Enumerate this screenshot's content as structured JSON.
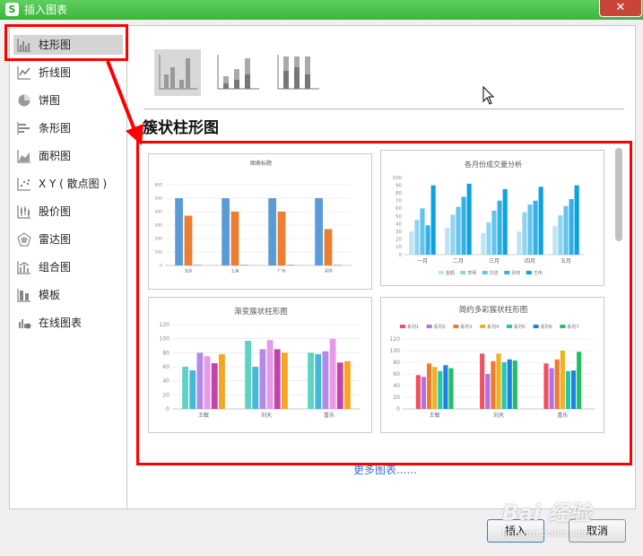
{
  "window": {
    "app_logo": "S",
    "title": "插入图表",
    "close_glyph": "✕"
  },
  "sidebar": {
    "items": [
      {
        "label": "柱形图",
        "icon": "column-chart-icon",
        "selected": true
      },
      {
        "label": "折线图",
        "icon": "line-chart-icon"
      },
      {
        "label": "饼图",
        "icon": "pie-chart-icon"
      },
      {
        "label": "条形图",
        "icon": "bar-chart-icon"
      },
      {
        "label": "面积图",
        "icon": "area-chart-icon"
      },
      {
        "label": "X Y ( 散点图 )",
        "icon": "scatter-chart-icon"
      },
      {
        "label": "股价图",
        "icon": "stock-chart-icon"
      },
      {
        "label": "雷达图",
        "icon": "radar-chart-icon"
      },
      {
        "label": "组合图",
        "icon": "combo-chart-icon"
      },
      {
        "label": "模板",
        "icon": "template-icon"
      },
      {
        "label": "在线图表",
        "icon": "online-chart-icon"
      }
    ]
  },
  "main": {
    "subtypes": [
      {
        "icon": "clustered-column-icon",
        "selected": true
      },
      {
        "icon": "stacked-column-icon"
      },
      {
        "icon": "percent-stacked-column-icon"
      }
    ],
    "section_title": "簇状柱形图",
    "more_charts_link": "更多图表......"
  },
  "chart_data": [
    {
      "type": "bar",
      "title": "图表标题",
      "categories": [
        "北京",
        "上海",
        "广州",
        "深圳"
      ],
      "series": [
        {
          "values": [
            500,
            500,
            500,
            500
          ],
          "color": "#5b9bd5"
        },
        {
          "values": [
            370,
            400,
            400,
            270
          ],
          "color": "#ed7d31"
        },
        {
          "values": [
            5,
            5,
            5,
            5
          ],
          "color": "#a5a5a5"
        }
      ],
      "ylim": [
        0,
        600
      ],
      "yticks": [
        "0",
        "100",
        "200",
        "300",
        "400",
        "500",
        "600"
      ],
      "legend_position": "bottom",
      "grid": true
    },
    {
      "type": "bar",
      "title": "各月份成交量分析",
      "categories": [
        "一月",
        "二月",
        "三月",
        "四月",
        "五月"
      ],
      "series": [
        {
          "name": "金额",
          "values": [
            30,
            35,
            28,
            30,
            37
          ],
          "color": "#bde3f4"
        },
        {
          "name": "李明",
          "values": [
            45,
            52,
            42,
            55,
            51
          ],
          "color": "#8fd3f0"
        },
        {
          "name": "刘洁",
          "values": [
            60,
            62,
            57,
            65,
            63
          ],
          "color": "#62c3ec"
        },
        {
          "name": "孙晓",
          "values": [
            38,
            75,
            70,
            70,
            72
          ],
          "color": "#33b1e6"
        },
        {
          "name": "王伟",
          "values": [
            90,
            92,
            85,
            88,
            90
          ],
          "color": "#0ba2e2"
        }
      ],
      "ylim": [
        0,
        100
      ],
      "yticks": [
        "0",
        "10",
        "20",
        "30",
        "40",
        "50",
        "60",
        "70",
        "80",
        "90",
        "100"
      ],
      "legend_position": "bottom",
      "grid": false
    },
    {
      "type": "bar",
      "title": "渐变簇状柱形图",
      "categories": [
        "王敏",
        "刘天",
        "喜乐"
      ],
      "series": [
        {
          "values": [
            60,
            97,
            80
          ],
          "color": "#5fd3c3"
        },
        {
          "values": [
            55,
            60,
            78
          ],
          "color": "#45b8d8"
        },
        {
          "values": [
            80,
            85,
            82
          ],
          "color": "#b48ae8"
        },
        {
          "values": [
            75,
            98,
            100
          ],
          "color": "#e59ae8"
        },
        {
          "values": [
            65,
            85,
            66
          ],
          "color": "#c244a8"
        },
        {
          "values": [
            78,
            80,
            68
          ],
          "color": "#f5a623"
        }
      ],
      "ylim": [
        0,
        120
      ],
      "yticks": [
        "0",
        "20",
        "40",
        "60",
        "80",
        "100",
        "120"
      ],
      "grid": true
    },
    {
      "type": "bar",
      "title": "简约多彩簇状柱形图",
      "categories": [
        "王敏",
        "刘天",
        "喜乐"
      ],
      "series": [
        {
          "name": "系列1",
          "values": [
            58,
            95,
            78
          ],
          "color": "#f05060"
        },
        {
          "name": "系列2",
          "values": [
            55,
            60,
            70
          ],
          "color": "#b070e8"
        },
        {
          "name": "系列3",
          "values": [
            78,
            82,
            85
          ],
          "color": "#f07a30"
        },
        {
          "name": "系列4",
          "values": [
            72,
            95,
            100
          ],
          "color": "#f0b020"
        },
        {
          "name": "系列5",
          "values": [
            65,
            80,
            65
          ],
          "color": "#20c8b0"
        },
        {
          "name": "系列6",
          "values": [
            75,
            85,
            66
          ],
          "color": "#2080e0"
        },
        {
          "name": "系列7",
          "values": [
            70,
            83,
            98
          ],
          "color": "#20c060"
        }
      ],
      "ylim": [
        0,
        120
      ],
      "yticks": [
        "0",
        "20",
        "40",
        "60",
        "80",
        "100",
        "120"
      ],
      "legend_position": "top",
      "grid": true
    }
  ],
  "footer": {
    "insert_label": "插入",
    "cancel_label": "取消"
  },
  "overlay": {
    "watermark": "Bai 经验",
    "watermark_sub": "jingyan.baidu.com",
    "annotation_color": "#ff0000"
  }
}
